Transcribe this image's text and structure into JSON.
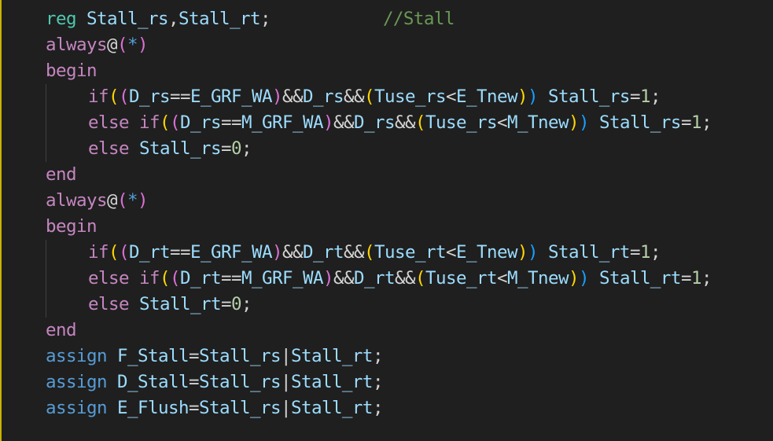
{
  "colors": {
    "background": "#1f1f1f",
    "keyword": "#569cd6",
    "control": "#c586c0",
    "variable": "#9cdcfe",
    "operator": "#d4d4d4",
    "number": "#b5cea8",
    "comment": "#6a9955",
    "type": "#4ec9b0",
    "bracket_level_1": "#ffd700",
    "bracket_level_2": "#da70d6",
    "bracket_level_3": "#179fff"
  },
  "lines": [
    {
      "indent": 0,
      "tokens": [
        {
          "t": "reg",
          "k": "type"
        },
        {
          "t": " ",
          "k": "punc"
        },
        {
          "t": "Stall_rs",
          "k": "var"
        },
        {
          "t": ",",
          "k": "punc"
        },
        {
          "t": "Stall_rt",
          "k": "var"
        },
        {
          "t": ";",
          "k": "punc"
        },
        {
          "t": "           ",
          "k": "punc"
        },
        {
          "t": "//Stall",
          "k": "com"
        }
      ]
    },
    {
      "indent": 0,
      "tokens": [
        {
          "t": "always",
          "k": "ctl"
        },
        {
          "t": "@",
          "k": "op"
        },
        {
          "t": "(",
          "k": "p2"
        },
        {
          "t": "*",
          "k": "kw"
        },
        {
          "t": ")",
          "k": "p2"
        }
      ]
    },
    {
      "indent": 0,
      "tokens": [
        {
          "t": "begin",
          "k": "ctl"
        }
      ]
    },
    {
      "indent": 1,
      "tokens": [
        {
          "t": "if",
          "k": "ctl"
        },
        {
          "t": "(",
          "k": "p1"
        },
        {
          "t": "(",
          "k": "p2"
        },
        {
          "t": "D_rs",
          "k": "var"
        },
        {
          "t": "==",
          "k": "op"
        },
        {
          "t": "E_GRF_WA",
          "k": "var"
        },
        {
          "t": ")",
          "k": "p2"
        },
        {
          "t": "&&",
          "k": "op"
        },
        {
          "t": "D_rs",
          "k": "var"
        },
        {
          "t": "&&",
          "k": "op"
        },
        {
          "t": "(",
          "k": "p1"
        },
        {
          "t": "Tuse_rs",
          "k": "var"
        },
        {
          "t": "<",
          "k": "op"
        },
        {
          "t": "E_Tnew",
          "k": "var"
        },
        {
          "t": ")",
          "k": "p1"
        },
        {
          "t": ")",
          "k": "p3"
        },
        {
          "t": " ",
          "k": "punc"
        },
        {
          "t": "Stall_rs",
          "k": "var"
        },
        {
          "t": "=",
          "k": "op"
        },
        {
          "t": "1",
          "k": "num"
        },
        {
          "t": ";",
          "k": "punc"
        }
      ]
    },
    {
      "indent": 1,
      "tokens": [
        {
          "t": "else",
          "k": "ctl"
        },
        {
          "t": " ",
          "k": "punc"
        },
        {
          "t": "if",
          "k": "ctl"
        },
        {
          "t": "(",
          "k": "p1"
        },
        {
          "t": "(",
          "k": "p2"
        },
        {
          "t": "D_rs",
          "k": "var"
        },
        {
          "t": "==",
          "k": "op"
        },
        {
          "t": "M_GRF_WA",
          "k": "var"
        },
        {
          "t": ")",
          "k": "p2"
        },
        {
          "t": "&&",
          "k": "op"
        },
        {
          "t": "D_rs",
          "k": "var"
        },
        {
          "t": "&&",
          "k": "op"
        },
        {
          "t": "(",
          "k": "p1"
        },
        {
          "t": "Tuse_rs",
          "k": "var"
        },
        {
          "t": "<",
          "k": "op"
        },
        {
          "t": "M_Tnew",
          "k": "var"
        },
        {
          "t": ")",
          "k": "p1"
        },
        {
          "t": ")",
          "k": "p3"
        },
        {
          "t": " ",
          "k": "punc"
        },
        {
          "t": "Stall_rs",
          "k": "var"
        },
        {
          "t": "=",
          "k": "op"
        },
        {
          "t": "1",
          "k": "num"
        },
        {
          "t": ";",
          "k": "punc"
        }
      ]
    },
    {
      "indent": 1,
      "tokens": [
        {
          "t": "else",
          "k": "ctl"
        },
        {
          "t": " ",
          "k": "punc"
        },
        {
          "t": "Stall_rs",
          "k": "var"
        },
        {
          "t": "=",
          "k": "op"
        },
        {
          "t": "0",
          "k": "num"
        },
        {
          "t": ";",
          "k": "punc"
        }
      ]
    },
    {
      "indent": 0,
      "tokens": [
        {
          "t": "end",
          "k": "ctl"
        }
      ]
    },
    {
      "indent": 0,
      "tokens": [
        {
          "t": "always",
          "k": "ctl"
        },
        {
          "t": "@",
          "k": "op"
        },
        {
          "t": "(",
          "k": "p2"
        },
        {
          "t": "*",
          "k": "kw"
        },
        {
          "t": ")",
          "k": "p2"
        }
      ]
    },
    {
      "indent": 0,
      "tokens": [
        {
          "t": "begin",
          "k": "ctl"
        }
      ]
    },
    {
      "indent": 1,
      "tokens": [
        {
          "t": "if",
          "k": "ctl"
        },
        {
          "t": "(",
          "k": "p1"
        },
        {
          "t": "(",
          "k": "p2"
        },
        {
          "t": "D_rt",
          "k": "var"
        },
        {
          "t": "==",
          "k": "op"
        },
        {
          "t": "E_GRF_WA",
          "k": "var"
        },
        {
          "t": ")",
          "k": "p2"
        },
        {
          "t": "&&",
          "k": "op"
        },
        {
          "t": "D_rt",
          "k": "var"
        },
        {
          "t": "&&",
          "k": "op"
        },
        {
          "t": "(",
          "k": "p1"
        },
        {
          "t": "Tuse_rt",
          "k": "var"
        },
        {
          "t": "<",
          "k": "op"
        },
        {
          "t": "E_Tnew",
          "k": "var"
        },
        {
          "t": ")",
          "k": "p1"
        },
        {
          "t": ")",
          "k": "p3"
        },
        {
          "t": " ",
          "k": "punc"
        },
        {
          "t": "Stall_rt",
          "k": "var"
        },
        {
          "t": "=",
          "k": "op"
        },
        {
          "t": "1",
          "k": "num"
        },
        {
          "t": ";",
          "k": "punc"
        }
      ]
    },
    {
      "indent": 1,
      "tokens": [
        {
          "t": "else",
          "k": "ctl"
        },
        {
          "t": " ",
          "k": "punc"
        },
        {
          "t": "if",
          "k": "ctl"
        },
        {
          "t": "(",
          "k": "p1"
        },
        {
          "t": "(",
          "k": "p2"
        },
        {
          "t": "D_rt",
          "k": "var"
        },
        {
          "t": "==",
          "k": "op"
        },
        {
          "t": "M_GRF_WA",
          "k": "var"
        },
        {
          "t": ")",
          "k": "p2"
        },
        {
          "t": "&&",
          "k": "op"
        },
        {
          "t": "D_rt",
          "k": "var"
        },
        {
          "t": "&&",
          "k": "op"
        },
        {
          "t": "(",
          "k": "p1"
        },
        {
          "t": "Tuse_rt",
          "k": "var"
        },
        {
          "t": "<",
          "k": "op"
        },
        {
          "t": "M_Tnew",
          "k": "var"
        },
        {
          "t": ")",
          "k": "p1"
        },
        {
          "t": ")",
          "k": "p3"
        },
        {
          "t": " ",
          "k": "punc"
        },
        {
          "t": "Stall_rt",
          "k": "var"
        },
        {
          "t": "=",
          "k": "op"
        },
        {
          "t": "1",
          "k": "num"
        },
        {
          "t": ";",
          "k": "punc"
        }
      ]
    },
    {
      "indent": 1,
      "tokens": [
        {
          "t": "else",
          "k": "ctl"
        },
        {
          "t": " ",
          "k": "punc"
        },
        {
          "t": "Stall_rt",
          "k": "var"
        },
        {
          "t": "=",
          "k": "op"
        },
        {
          "t": "0",
          "k": "num"
        },
        {
          "t": ";",
          "k": "punc"
        }
      ]
    },
    {
      "indent": 0,
      "tokens": [
        {
          "t": "end",
          "k": "ctl"
        }
      ]
    },
    {
      "indent": 0,
      "tokens": [
        {
          "t": "assign",
          "k": "kw"
        },
        {
          "t": " ",
          "k": "punc"
        },
        {
          "t": "F_Stall",
          "k": "var"
        },
        {
          "t": "=",
          "k": "op"
        },
        {
          "t": "Stall_rs",
          "k": "var"
        },
        {
          "t": "|",
          "k": "op"
        },
        {
          "t": "Stall_rt",
          "k": "var"
        },
        {
          "t": ";",
          "k": "punc"
        }
      ]
    },
    {
      "indent": 0,
      "tokens": [
        {
          "t": "assign",
          "k": "kw"
        },
        {
          "t": " ",
          "k": "punc"
        },
        {
          "t": "D_Stall",
          "k": "var"
        },
        {
          "t": "=",
          "k": "op"
        },
        {
          "t": "Stall_rs",
          "k": "var"
        },
        {
          "t": "|",
          "k": "op"
        },
        {
          "t": "Stall_rt",
          "k": "var"
        },
        {
          "t": ";",
          "k": "punc"
        }
      ]
    },
    {
      "indent": 0,
      "tokens": [
        {
          "t": "assign",
          "k": "kw"
        },
        {
          "t": " ",
          "k": "punc"
        },
        {
          "t": "E_Flush",
          "k": "var"
        },
        {
          "t": "=",
          "k": "op"
        },
        {
          "t": "Stall_rs",
          "k": "var"
        },
        {
          "t": "|",
          "k": "op"
        },
        {
          "t": "Stall_rt",
          "k": "var"
        },
        {
          "t": ";",
          "k": "punc"
        }
      ]
    }
  ]
}
